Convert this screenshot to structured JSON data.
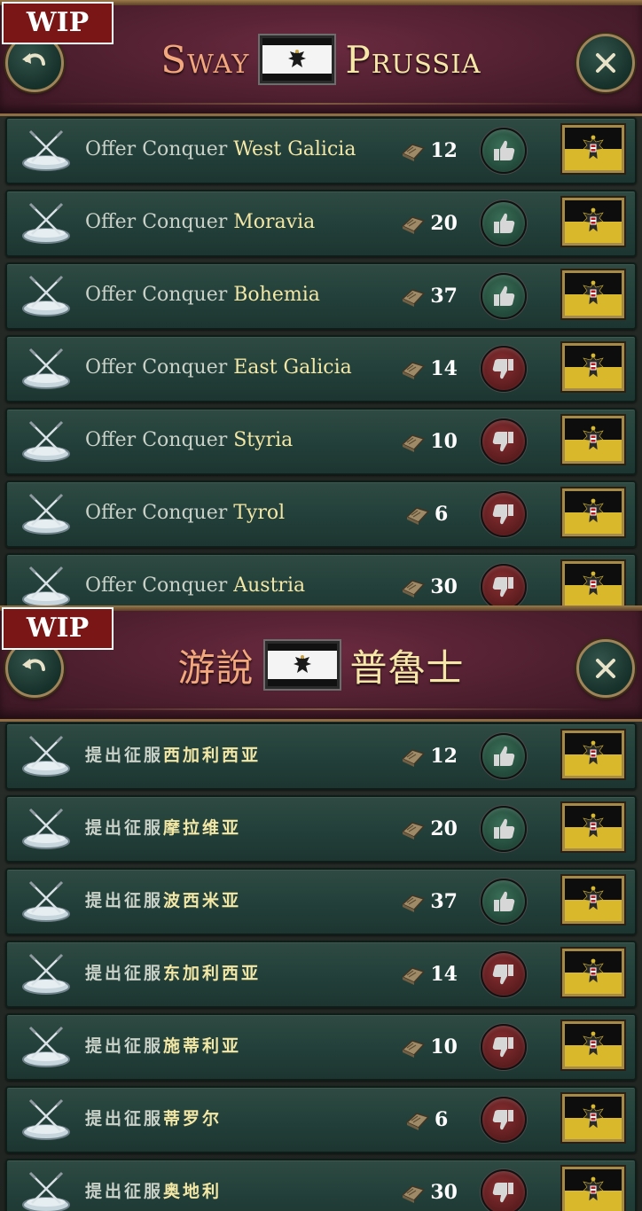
{
  "panels": [
    {
      "wip": "WIP",
      "title_left": "Sway",
      "title_right": "Prussia",
      "rows": [
        {
          "action": "Offer Conquer ",
          "target": "West Galicia",
          "cost": "12",
          "approve": true
        },
        {
          "action": "Offer Conquer ",
          "target": "Moravia",
          "cost": "20",
          "approve": true
        },
        {
          "action": "Offer Conquer ",
          "target": "Bohemia",
          "cost": "37",
          "approve": true
        },
        {
          "action": "Offer Conquer ",
          "target": "East Galicia",
          "cost": "14",
          "approve": false
        },
        {
          "action": "Offer Conquer ",
          "target": "Styria",
          "cost": "10",
          "approve": false
        },
        {
          "action": "Offer Conquer ",
          "target": "Tyrol",
          "cost": "6",
          "approve": false
        },
        {
          "action": "Offer Conquer ",
          "target": "Austria",
          "cost": "30",
          "approve": false
        }
      ]
    },
    {
      "wip": "WIP",
      "title_left": "游說",
      "title_right": "普魯士",
      "rows": [
        {
          "action": "提出征服",
          "target": "西加利西亚",
          "cost": "12",
          "approve": true
        },
        {
          "action": "提出征服",
          "target": "摩拉维亚",
          "cost": "20",
          "approve": true
        },
        {
          "action": "提出征服",
          "target": "波西米亚",
          "cost": "37",
          "approve": true
        },
        {
          "action": "提出征服",
          "target": "东加利西亚",
          "cost": "14",
          "approve": false
        },
        {
          "action": "提出征服",
          "target": "施蒂利亚",
          "cost": "10",
          "approve": false
        },
        {
          "action": "提出征服",
          "target": "蒂罗尔",
          "cost": "6",
          "approve": false
        },
        {
          "action": "提出征服",
          "target": "奥地利",
          "cost": "30",
          "approve": false
        }
      ]
    }
  ],
  "icons": {
    "back": "back-arrow-icon",
    "close": "close-x-icon",
    "deal": "crossed-swords-icon",
    "favor": "favor-tablet-icon",
    "approve": "thumbs-up-icon",
    "reject": "thumbs-down-icon",
    "target_flag": "austria-flag",
    "header_flag": "prussia-flag"
  },
  "colors": {
    "header": "#4e1f2f",
    "row": "#23403a",
    "title_left": "#f3a77c",
    "title_right": "#f6e7a8",
    "approve": "#22483a",
    "reject": "#5a1c1e",
    "wip_bg": "#7a1616"
  }
}
